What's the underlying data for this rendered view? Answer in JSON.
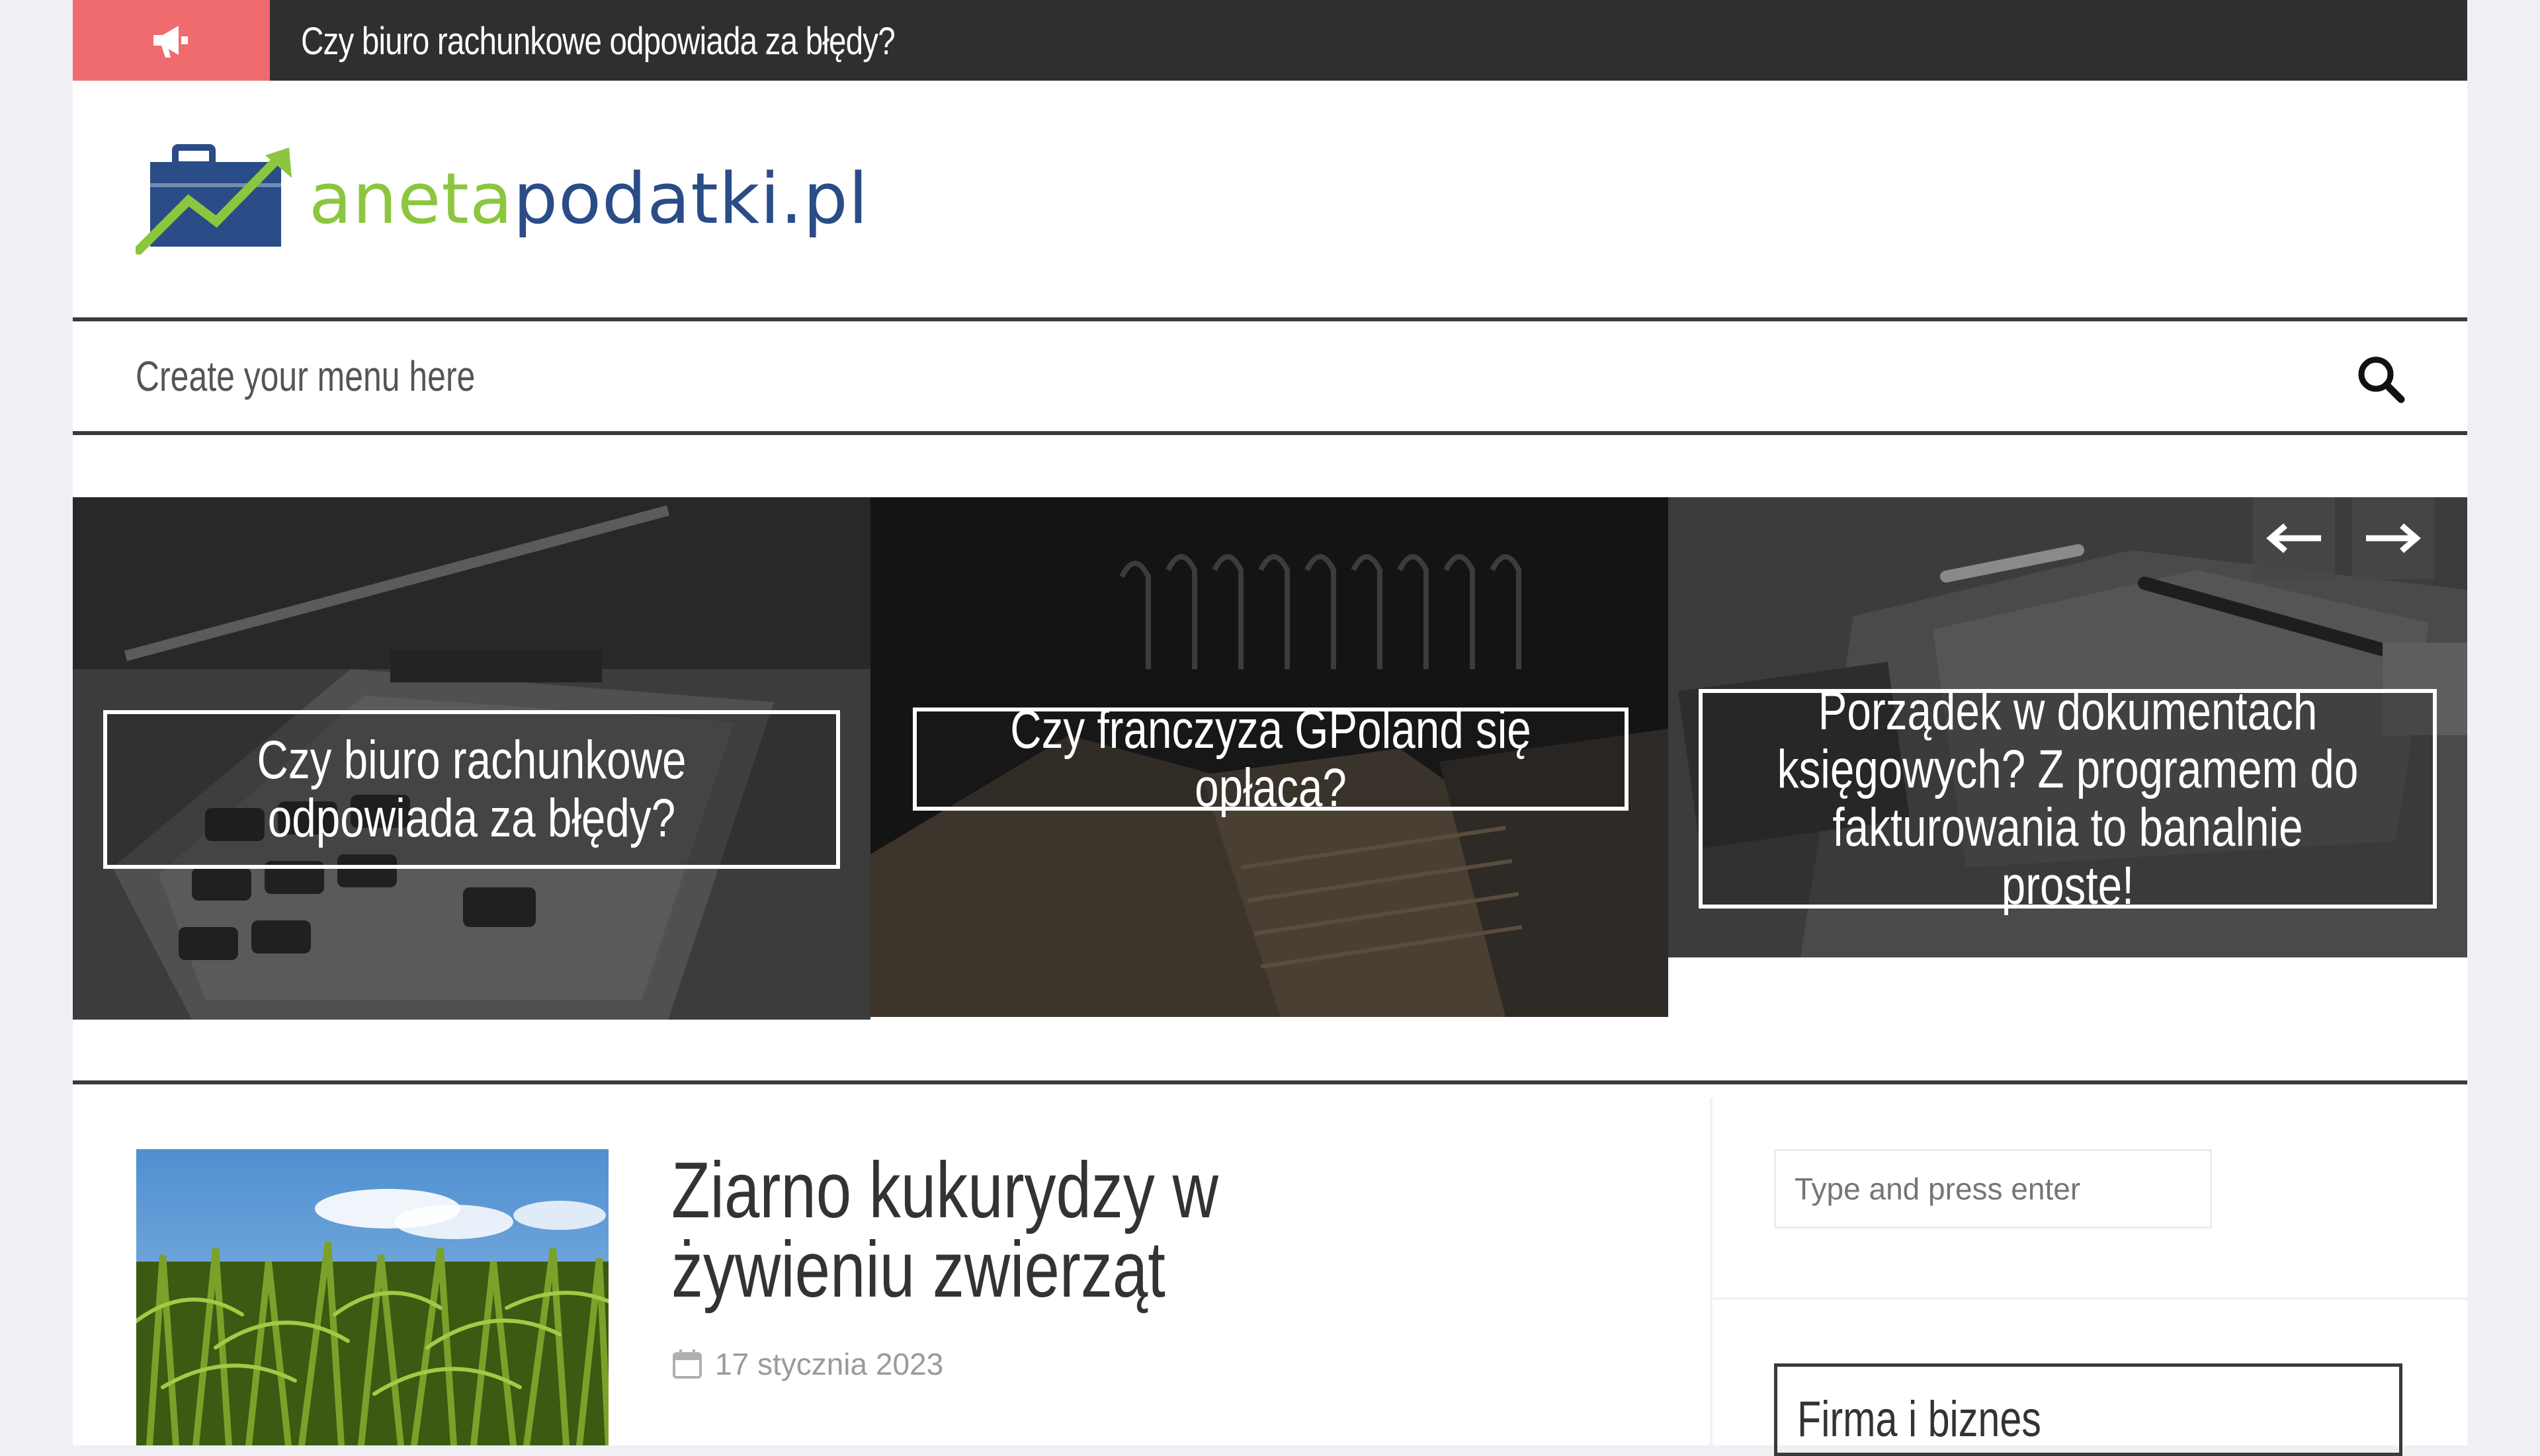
{
  "ticker": {
    "icon": "megaphone-icon",
    "text": "Czy biuro rachunkowe odpowiada za błędy?"
  },
  "logo": {
    "part1": "aneta",
    "part2": "podatki.pl",
    "icon": "briefcase-growth-icon",
    "colors": {
      "green": "#8cc63f",
      "blue": "#2a4c87"
    }
  },
  "nav": {
    "menu_text": "Create your menu here",
    "search_icon": "search-icon"
  },
  "slider": {
    "slides": [
      {
        "title": "Czy biuro rachunkowe odpowiada za błędy?"
      },
      {
        "title": "Czy franczyza GPoland się opłaca?"
      },
      {
        "title": "Porządek w dokumentach księgowych? Z programem do fakturowania to banalnie proste!"
      }
    ],
    "prev_icon": "arrow-left-icon",
    "next_icon": "arrow-right-icon"
  },
  "post": {
    "title": "Ziarno kukurydzy w żywieniu zwierząt",
    "date": "17 stycznia 2023",
    "date_icon": "calendar-icon"
  },
  "sidebar": {
    "search_placeholder": "Type and press enter",
    "widget_title": "Firma i biznes"
  },
  "colors": {
    "ticker_bg": "#2f2f2f",
    "ticker_accent": "#f06b6e",
    "border_dark": "#3a3a3a"
  }
}
